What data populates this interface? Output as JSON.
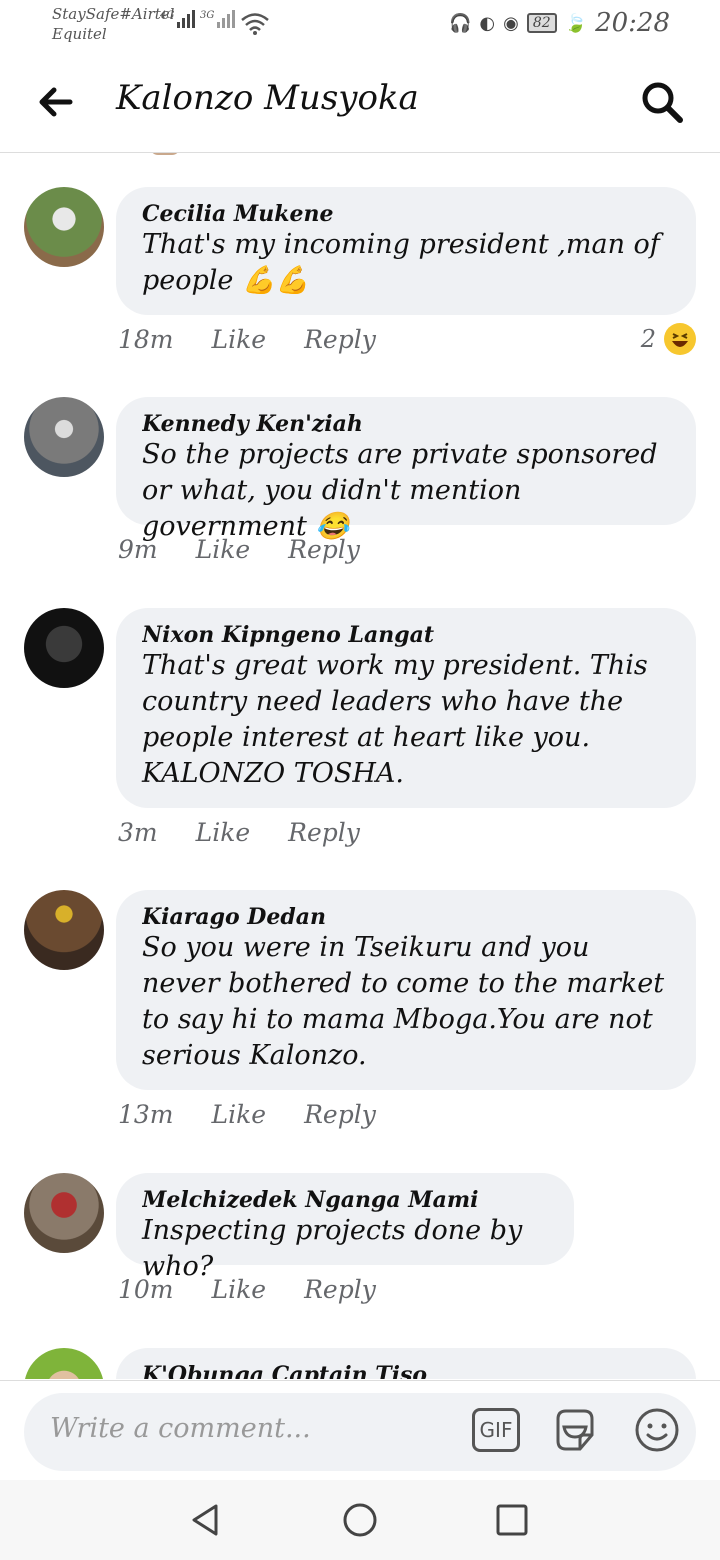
{
  "status": {
    "carrier_line1": "StaySafe#Airtel",
    "carrier_line2": "Equitel",
    "net1": "4G",
    "net2": "3G",
    "battery": "82",
    "time": "20:28"
  },
  "header": {
    "title": "Kalonzo Musyoka"
  },
  "comments": [
    {
      "author": "Cecilia Mukene",
      "text": "That's my incoming president ,man of people 💪💪",
      "time": "18m",
      "like": "Like",
      "reply": "Reply",
      "reaction_count": "2"
    },
    {
      "author": "Kennedy Ken'ziah",
      "text": "So the projects are private sponsored or what, you didn't mention government 😂",
      "time": "9m",
      "like": "Like",
      "reply": "Reply"
    },
    {
      "author": "Nixon Kipngeno Langat",
      "text": "That's great work my president. This country need leaders who have the people interest at heart like you. KALONZO TOSHA.",
      "time": "3m",
      "like": "Like",
      "reply": "Reply"
    },
    {
      "author": "Kiarago Dedan",
      "text": "So you were in Tseikuru and you never bothered to come to the market to say hi to mama Mboga.You are not serious Kalonzo.",
      "time": "13m",
      "like": "Like",
      "reply": "Reply"
    },
    {
      "author": "Melchizedek Nganga Mami",
      "text": "Inspecting projects done by who?",
      "time": "10m",
      "like": "Like",
      "reply": "Reply"
    },
    {
      "author": "K'Obunga Captain Tiso"
    }
  ],
  "composer": {
    "placeholder": "Write a comment...",
    "gif_label": "GIF"
  },
  "icons": {
    "back": "arrow-left-icon",
    "search": "search-icon",
    "sticker": "sticker-icon",
    "emoji": "smiley-icon",
    "nav_back": "triangle-back-icon",
    "nav_home": "circle-home-icon",
    "nav_recents": "square-recents-icon"
  },
  "colors": {
    "bubble": "#eff1f4",
    "secondary_text": "#65676b",
    "reaction": "#f7c72e"
  }
}
